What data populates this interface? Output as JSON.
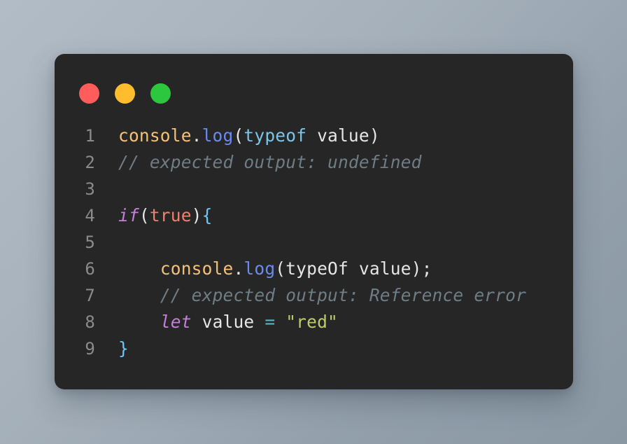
{
  "window": {
    "controls": [
      {
        "name": "close",
        "label": "Close",
        "color": "#ff5c5c"
      },
      {
        "name": "minimize",
        "label": "Minimize",
        "color": "#ffbd2e"
      },
      {
        "name": "maximize",
        "label": "Maximize",
        "color": "#2dc73f"
      }
    ]
  },
  "editor": {
    "background": "#262626",
    "page_background": "#a6b1bb",
    "line_number_color": "#8b8b8b",
    "lines": [
      {
        "number": "1",
        "text": "console.log(typeof value)",
        "tokens": [
          {
            "t": "console",
            "c": "tok-object"
          },
          {
            "t": ".",
            "c": "tok-punct"
          },
          {
            "t": "log",
            "c": "tok-method"
          },
          {
            "t": "(",
            "c": "tok-punct"
          },
          {
            "t": "typeof",
            "c": "tok-operator-kw"
          },
          {
            "t": " value",
            "c": "tok-plain"
          },
          {
            "t": ")",
            "c": "tok-punct"
          }
        ]
      },
      {
        "number": "2",
        "text": "// expected output: undefined",
        "tokens": [
          {
            "t": "// expected output: undefined",
            "c": "tok-comment"
          }
        ]
      },
      {
        "number": "3",
        "text": "",
        "tokens": []
      },
      {
        "number": "4",
        "text": "if(true){",
        "tokens": [
          {
            "t": "if",
            "c": "tok-keyword"
          },
          {
            "t": "(",
            "c": "tok-punct"
          },
          {
            "t": "true",
            "c": "tok-bool"
          },
          {
            "t": ")",
            "c": "tok-punct"
          },
          {
            "t": "{",
            "c": "tok-brace"
          }
        ]
      },
      {
        "number": "5",
        "text": "",
        "tokens": []
      },
      {
        "number": "6",
        "text": "    console.log(typeOf value);",
        "tokens": [
          {
            "t": "    ",
            "c": "tok-plain"
          },
          {
            "t": "console",
            "c": "tok-object"
          },
          {
            "t": ".",
            "c": "tok-punct"
          },
          {
            "t": "log",
            "c": "tok-method"
          },
          {
            "t": "(typeOf value);",
            "c": "tok-plain"
          }
        ]
      },
      {
        "number": "7",
        "text": "    // expected output: Reference error",
        "tokens": [
          {
            "t": "    ",
            "c": "tok-plain"
          },
          {
            "t": "// expected output: Reference error",
            "c": "tok-comment"
          }
        ]
      },
      {
        "number": "8",
        "text": "    let value = \"red\"",
        "tokens": [
          {
            "t": "    ",
            "c": "tok-plain"
          },
          {
            "t": "let",
            "c": "tok-keyword"
          },
          {
            "t": " value ",
            "c": "tok-plain"
          },
          {
            "t": "=",
            "c": "tok-assign"
          },
          {
            "t": " ",
            "c": "tok-plain"
          },
          {
            "t": "\"red\"",
            "c": "tok-string"
          }
        ]
      },
      {
        "number": "9",
        "text": "}",
        "tokens": [
          {
            "t": "}",
            "c": "tok-brace"
          }
        ]
      }
    ]
  }
}
